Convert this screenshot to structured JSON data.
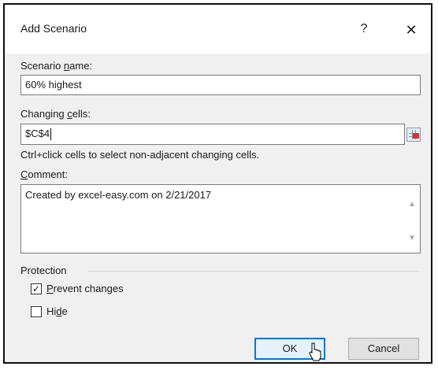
{
  "dialog": {
    "title": "Add Scenario",
    "help_label": "?",
    "close_label": "✕"
  },
  "scenario_name": {
    "label_pre": "Scenario ",
    "label_key": "n",
    "label_post": "ame:",
    "value": "60% highest"
  },
  "changing_cells": {
    "label_pre": "Changing ",
    "label_key": "c",
    "label_post": "ells:",
    "value": "$C$4",
    "hint": "Ctrl+click cells to select non-adjacent changing cells.",
    "picker_icon": "range-picker-icon"
  },
  "comment": {
    "label_pre": "",
    "label_key": "C",
    "label_post": "omment:",
    "value": "Created by excel-easy.com on 2/21/2017"
  },
  "protection": {
    "label": "Protection",
    "prevent_changes": {
      "label_key": "P",
      "label_post": "revent changes",
      "checked": true,
      "mark": "✓"
    },
    "hide": {
      "label_pre": "Hi",
      "label_key": "d",
      "label_post": "e",
      "checked": false
    }
  },
  "buttons": {
    "ok": "OK",
    "cancel": "Cancel"
  },
  "colors": {
    "accent": "#0078d7",
    "dialog_bg": "#f0f0f0"
  }
}
